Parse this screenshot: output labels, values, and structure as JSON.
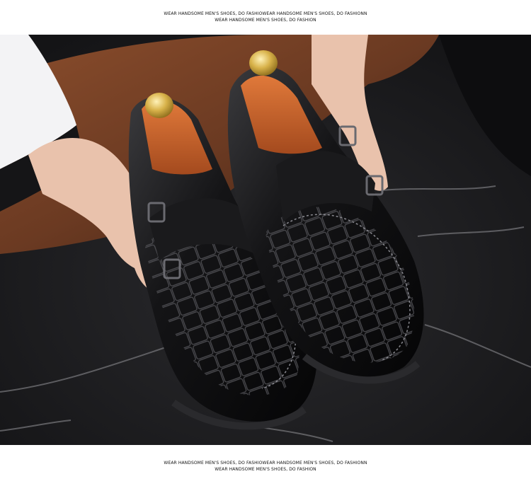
{
  "header_caption": {
    "line1": "WEAR HANDSOME MEN'S SHOES, DO FASHIOWEAR HANDSOME MEN'S SHOES, DO FASHIONN",
    "line2": "WEAR HANDSOME MEN'S SHOES, DO FASHION"
  },
  "footer_caption": {
    "line1": "WEAR HANDSOME MEN'S SHOES, DO FASHIOWEAR HANDSOME MEN'S SHOES, DO FASHIONN",
    "line2": "WEAR HANDSOME MEN'S SHOES, DO FASHION"
  },
  "photo": {
    "subject": "black double monk strap croc-embossed shoes held in hands",
    "colors": {
      "floor": "#1c1c1e",
      "marble_vein": "#6e6e72",
      "leather_chair": "#6b3a22",
      "shoe_leather": "#111112",
      "shoe_highlight": "#4a4a4e",
      "shoe_tree_wood": "#c8622e",
      "shoe_tree_knob": "#d8b24a",
      "skin": "#e9c2ac",
      "shirt": "#f3f3f5"
    }
  }
}
